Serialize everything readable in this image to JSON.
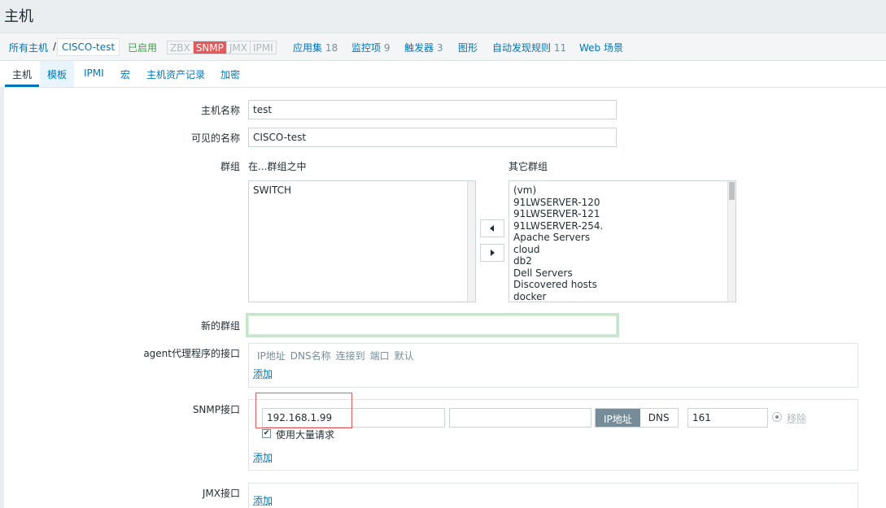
{
  "header": {
    "title": "主机"
  },
  "crumbs": {
    "all_hosts": "所有主机",
    "separator": "/",
    "current_host": "CISCO-test",
    "status": "已启用",
    "protocols": [
      "ZBX",
      "SNMP",
      "JMX",
      "IPMI"
    ],
    "active_protocol": "SNMP",
    "links": [
      {
        "label": "应用集",
        "count": "18"
      },
      {
        "label": "监控项",
        "count": "9"
      },
      {
        "label": "触发器",
        "count": "3"
      },
      {
        "label": "图形",
        "count": ""
      },
      {
        "label": "自动发现规则",
        "count": "11"
      },
      {
        "label": "Web 场景",
        "count": ""
      }
    ]
  },
  "tabs": [
    "主机",
    "模板",
    "IPMI",
    "宏",
    "主机资产记录",
    "加密"
  ],
  "active_tab": "主机",
  "form": {
    "host_name_label": "主机名称",
    "host_name_value": "test",
    "visible_name_label": "可见的名称",
    "visible_name_value": "CISCO-test",
    "groups_label": "群组",
    "in_groups_label": "在...群组之中",
    "other_groups_label": "其它群组",
    "in_groups": [
      "SWITCH"
    ],
    "other_groups": [
      "(vm)",
      "91LWSERVER-120",
      "91LWSERVER-121",
      "91LWSERVER-254.",
      "Apache Servers",
      "cloud",
      "db2",
      "Dell Servers",
      "Discovered hosts",
      "docker"
    ],
    "new_group_label": "新的群组",
    "new_group_value": "",
    "agent_label": "agent代理程序的接口",
    "agent_columns": [
      "IP地址",
      "DNS名称",
      "连接到",
      "端口",
      "默认"
    ],
    "add_label": "添加",
    "snmp_label": "SNMP接口",
    "snmp_ip": "192.168.1.99",
    "snmp_dns": "",
    "connect_ip": "IP地址",
    "connect_dns": "DNS",
    "snmp_port": "161",
    "remove_label": "移除",
    "bulk_label": "使用大量请求",
    "jmx_label": "JMX接口"
  }
}
